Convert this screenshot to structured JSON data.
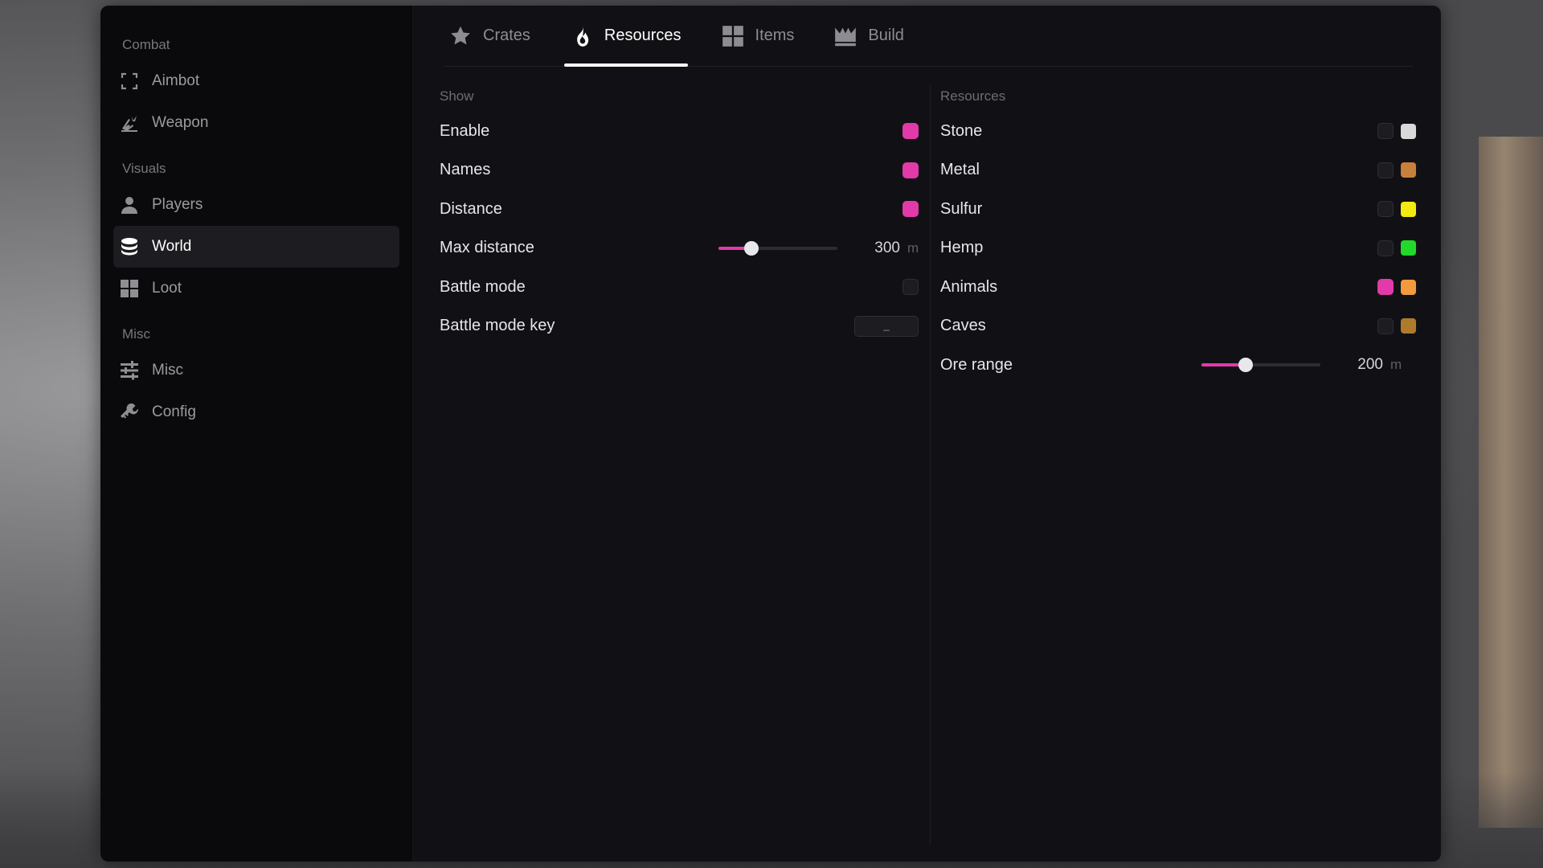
{
  "sidebar": {
    "sections": [
      {
        "label": "Combat",
        "items": [
          {
            "label": "Aimbot",
            "icon": "crosshair-frame-icon"
          },
          {
            "label": "Weapon",
            "icon": "weapon-icon"
          }
        ]
      },
      {
        "label": "Visuals",
        "items": [
          {
            "label": "Players",
            "icon": "user-icon"
          },
          {
            "label": "World",
            "icon": "globe-icon",
            "active": true
          },
          {
            "label": "Loot",
            "icon": "grid-icon"
          }
        ]
      },
      {
        "label": "Misc",
        "items": [
          {
            "label": "Misc",
            "icon": "sliders-icon"
          },
          {
            "label": "Config",
            "icon": "wrench-icon"
          }
        ]
      }
    ]
  },
  "tabs": [
    {
      "label": "Crates",
      "icon": "star-icon"
    },
    {
      "label": "Resources",
      "icon": "flame-icon",
      "active": true
    },
    {
      "label": "Items",
      "icon": "grid-icon"
    },
    {
      "label": "Build",
      "icon": "crown-icon"
    }
  ],
  "left_panel": {
    "title": "Show",
    "enable": {
      "label": "Enable",
      "checked": true
    },
    "names": {
      "label": "Names",
      "checked": true
    },
    "distance": {
      "label": "Distance",
      "checked": true
    },
    "max_distance": {
      "label": "Max distance",
      "value": "300",
      "unit": "m",
      "fraction": 0.28
    },
    "battle_mode": {
      "label": "Battle mode",
      "checked": false
    },
    "battle_mode_key": {
      "label": "Battle mode key",
      "value": "_"
    }
  },
  "right_panel": {
    "title": "Resources",
    "stone": {
      "label": "Stone",
      "checked": false,
      "color": "#d9d9d9"
    },
    "metal": {
      "label": "Metal",
      "checked": false,
      "color": "#c8803c"
    },
    "sulfur": {
      "label": "Sulfur",
      "checked": false,
      "color": "#f2ea10"
    },
    "hemp": {
      "label": "Hemp",
      "checked": false,
      "color": "#22d82a"
    },
    "animals": {
      "label": "Animals",
      "checked": true,
      "color": "#f39a3c"
    },
    "caves": {
      "label": "Caves",
      "checked": false,
      "color": "#b07a2c"
    },
    "ore_range": {
      "label": "Ore range",
      "value": "200",
      "unit": "m",
      "fraction": 0.37
    }
  },
  "colors": {
    "accent": "#e23aa8",
    "panel": "#111115",
    "sidebar": "#0a0a0c"
  }
}
